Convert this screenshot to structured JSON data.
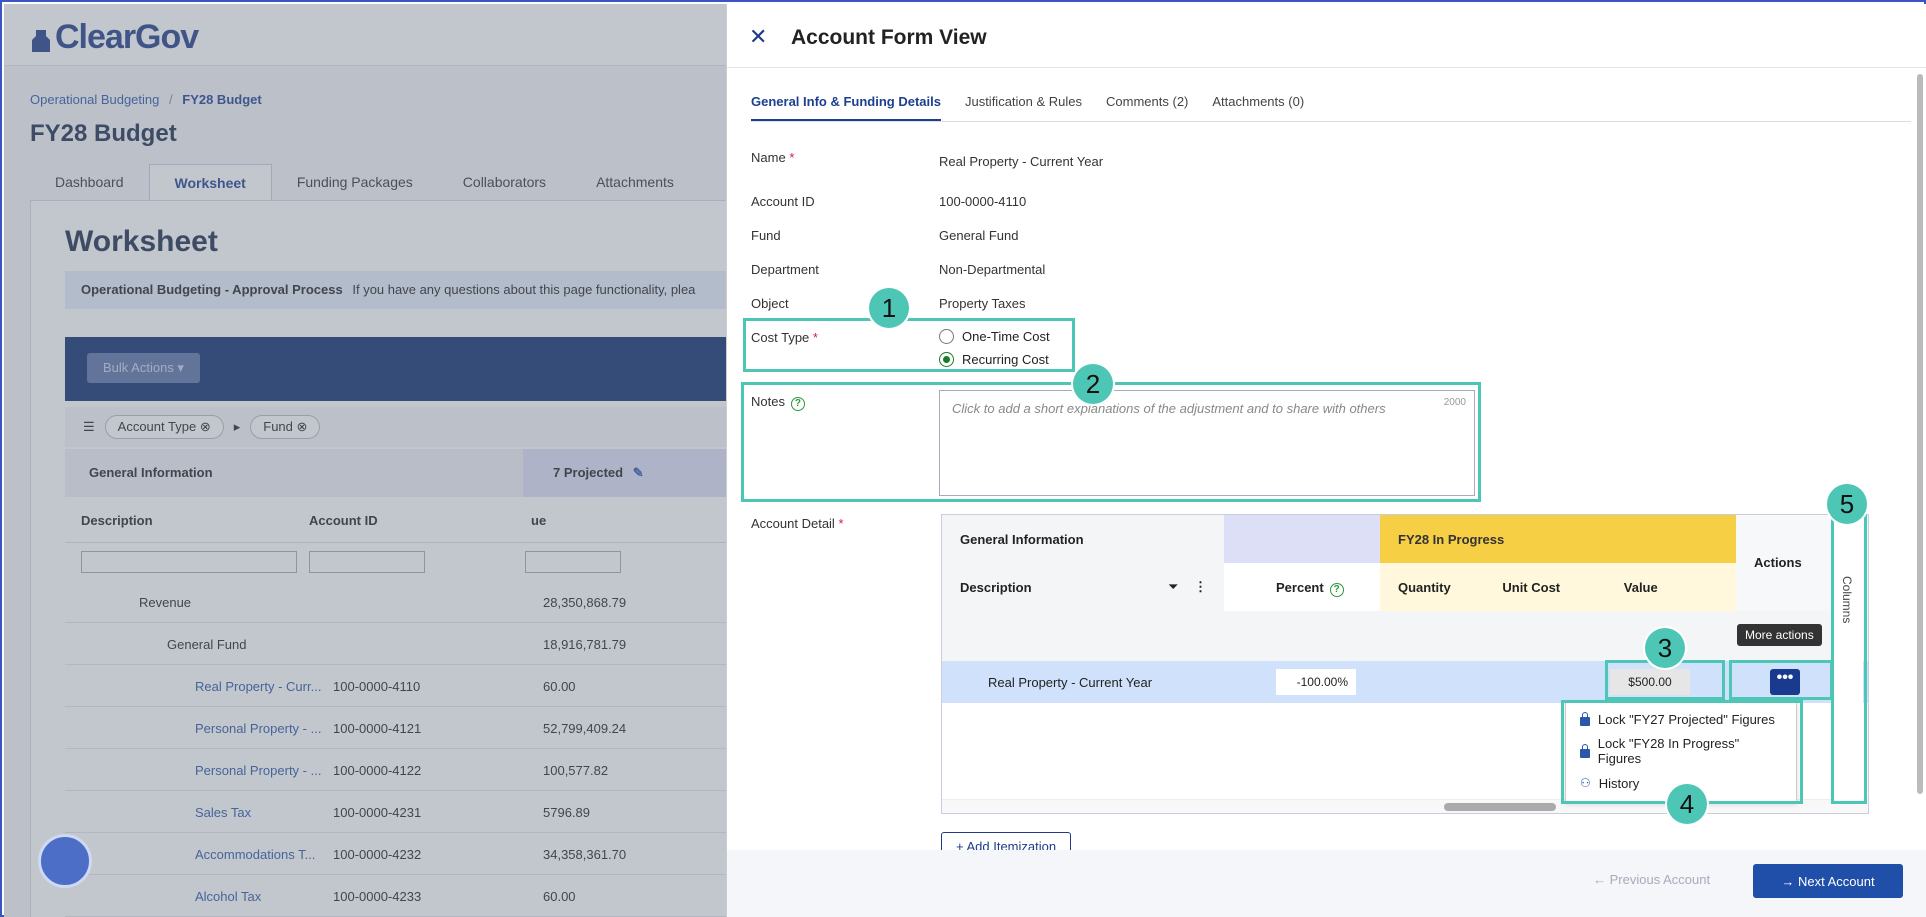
{
  "app": {
    "logo": "ClearGov"
  },
  "breadcrumb": {
    "parent": "Operational Budgeting",
    "sep": "/",
    "current": "FY28 Budget"
  },
  "page_title": "FY28 Budget",
  "tabs": [
    "Dashboard",
    "Worksheet",
    "Funding Packages",
    "Collaborators",
    "Attachments"
  ],
  "worksheet": {
    "title": "Worksheet",
    "info_bold": "Operational Budgeting - Approval Process",
    "info_text": "If you have any questions about this page functionality, plea",
    "bulk_actions": "Bulk Actions ▾",
    "chips": [
      "Account Type",
      "Fund"
    ],
    "group_header": "General Information",
    "projected_header": "7 Projected",
    "col_description": "Description",
    "col_account_id": "Account ID",
    "col_value": "ue",
    "rows": [
      {
        "desc": "Revenue",
        "id": "",
        "value": "28,350,868.79"
      },
      {
        "desc": "General Fund",
        "id": "",
        "value": "18,916,781.79"
      },
      {
        "desc": "Real Property - Curr...",
        "id": "100-0000-4110",
        "value": "60.00"
      },
      {
        "desc": "Personal Property - ...",
        "id": "100-0000-4121",
        "value": "52,799,409.24"
      },
      {
        "desc": "Personal Property - ...",
        "id": "100-0000-4122",
        "value": "100,577.82"
      },
      {
        "desc": "Sales Tax",
        "id": "100-0000-4231",
        "value": "5796.89"
      },
      {
        "desc": "Accommodations T...",
        "id": "100-0000-4232",
        "value": "34,358,361.70"
      },
      {
        "desc": "Alcohol Tax",
        "id": "100-0000-4233",
        "value": "60.00"
      }
    ]
  },
  "drawer": {
    "title": "Account Form View",
    "tabs": [
      "General Info & Funding Details",
      "Justification & Rules",
      "Comments (2)",
      "Attachments (0)"
    ],
    "fields": {
      "name_label": "Name",
      "name_value": "Real Property - Current Year",
      "account_id_label": "Account ID",
      "account_id_value": "100-0000-4110",
      "fund_label": "Fund",
      "fund_value": "General Fund",
      "dept_label": "Department",
      "dept_value": "Non-Departmental",
      "object_label": "Object",
      "object_value": "Property Taxes",
      "cost_type_label": "Cost Type",
      "cost_type_options": [
        "One-Time Cost",
        "Recurring Cost"
      ],
      "cost_type_selected": "Recurring Cost",
      "notes_label": "Notes",
      "notes_placeholder": "Click to add a short explanations of the adjustment and to share with others",
      "notes_limit": "2000",
      "account_detail_label": "Account Detail"
    },
    "grid": {
      "group_general": "General Information",
      "group_fy28": "FY28  In Progress",
      "actions": "Actions",
      "col_description": "Description",
      "col_percent": "Percent",
      "col_quantity": "Quantity",
      "col_unit_cost": "Unit Cost",
      "col_value": "Value",
      "row_desc": "Real Property - Current Year",
      "row_percent": "-100.00%",
      "row_value": "$500.00",
      "tooltip": "More actions",
      "menu": [
        "Lock \"FY27 Projected\" Figures",
        "Lock \"FY28 In Progress\" Figures",
        "History"
      ],
      "columns_label": "Columns"
    },
    "add_itemization": "+ Add Itemization",
    "prev_button": "← Previous Account",
    "next_button": "→ Next Account"
  },
  "callouts": [
    "1",
    "2",
    "3",
    "4",
    "5"
  ],
  "colors": {
    "accent": "#1f3c88",
    "highlight": "#4ec6b5",
    "fy28": "#f7cf45",
    "projected": "#dcdff5"
  }
}
